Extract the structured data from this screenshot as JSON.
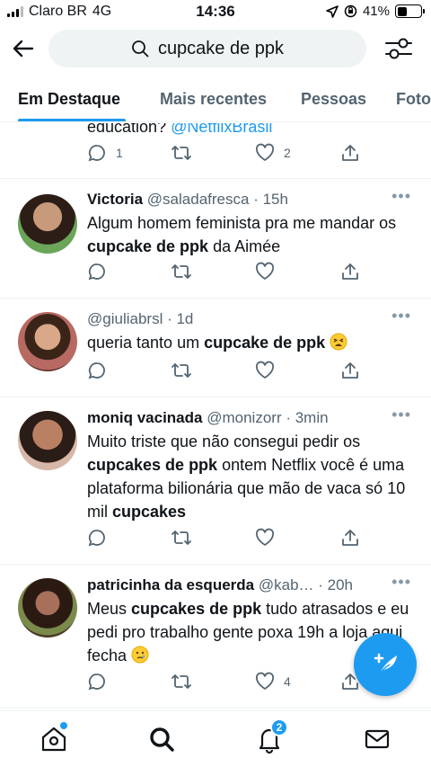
{
  "status_bar": {
    "carrier": "Claro BR",
    "network": "4G",
    "time": "14:36",
    "battery": "41%",
    "battery_level": 0.41
  },
  "search": {
    "query": "cupcake de ppk"
  },
  "tabs": [
    {
      "label": "Em Destaque",
      "active": true
    },
    {
      "label": "Mais recentes",
      "active": false
    },
    {
      "label": "Pessoas",
      "active": false
    },
    {
      "label": "Fotos",
      "active": false
    }
  ],
  "partial_tweet": {
    "text": "education? ",
    "link": "@NetflixBrasil",
    "replies": "1",
    "likes": "2"
  },
  "tweets": [
    {
      "name": "Victoria",
      "handle": "@saladafresca",
      "time": "· 15h",
      "parts": [
        [
          "Algum homem feminista pra me mandar os ",
          false
        ],
        [
          "cupcake de ppk",
          true
        ],
        [
          " da Aimée",
          false
        ]
      ],
      "replies": "",
      "likes": ""
    },
    {
      "name": "",
      "handle": "@giuliabrsl",
      "time": "· 1d",
      "parts": [
        [
          "queria tanto um ",
          false
        ],
        [
          "cupcake de ppk",
          true
        ],
        [
          " ",
          false
        ]
      ],
      "emoji": "tired-face",
      "replies": "",
      "likes": ""
    },
    {
      "name": "moniq vacinada",
      "handle": "@monizorr",
      "time": "· 3min",
      "parts": [
        [
          "Muito triste que não consegui pedir os ",
          false
        ],
        [
          "cupcakes de ppk",
          true
        ],
        [
          " ontem Netflix você é uma plataforma bilionária que mão de vaca só 10 mil ",
          false
        ],
        [
          "cupcakes",
          true
        ]
      ],
      "replies": "",
      "likes": ""
    },
    {
      "name": "patricinha da esquerda",
      "handle": "@kab…",
      "time": "· 20h",
      "parts": [
        [
          "Meus ",
          false
        ],
        [
          "cupcakes de ppk",
          true
        ],
        [
          " tudo atrasados e eu pedi pro trabalho gente poxa 19h a loja aqui fecha ",
          false
        ]
      ],
      "emoji": "crying-face",
      "replies": "",
      "likes": "4"
    }
  ],
  "bottom_nav": {
    "notifications_count": "2"
  },
  "colors": {
    "accent": "#1d9bf0",
    "text": "#0f1419",
    "secondary": "#536471"
  }
}
